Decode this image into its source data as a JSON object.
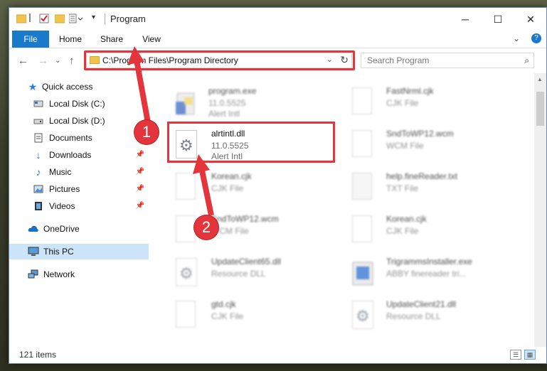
{
  "titlebar": {
    "title": "Program",
    "minimize": "─",
    "maximize": "☐",
    "close": "✕"
  },
  "ribbon": {
    "tabs": [
      {
        "label": "File"
      },
      {
        "label": "Home"
      },
      {
        "label": "Share"
      },
      {
        "label": "View"
      }
    ],
    "collapse": "⌄",
    "help": "?"
  },
  "nav": {
    "back": "←",
    "forward": "→",
    "recent": "⌄",
    "up": "↑"
  },
  "address": {
    "path": "C:\\Program Files\\Program Directory",
    "dropdown": "⌄",
    "refresh": "↻"
  },
  "search": {
    "placeholder": "Search Program",
    "icon": "⌕"
  },
  "sidebar": {
    "items": [
      {
        "label": "Quick access"
      },
      {
        "label": "Local Disk (C:)"
      },
      {
        "label": "Local Disk (D:)"
      },
      {
        "label": "Documents"
      },
      {
        "label": "Downloads",
        "pin": "📌"
      },
      {
        "label": "Music",
        "pin": "📌"
      },
      {
        "label": "Pictures",
        "pin": "📌"
      },
      {
        "label": "Videos",
        "pin": "📌"
      },
      {
        "label": "OneDrive"
      },
      {
        "label": "This PC"
      },
      {
        "label": "Network"
      }
    ]
  },
  "files": [
    {
      "name": "program.exe",
      "l1": "11.0.5525",
      "l2": "Alert Intl",
      "icon": "exe-icon"
    },
    {
      "name": "FastNrml.cjk",
      "l1": "CJK File",
      "l2": "",
      "icon": "file-icon"
    },
    {
      "name": "alrtintl.dll",
      "l1": "11.0.5525",
      "l2": "Alert Intl",
      "icon": "dll-gear-icon"
    },
    {
      "name": "SndToWP12.wcm",
      "l1": "WCM File",
      "l2": "",
      "icon": "file-icon"
    },
    {
      "name": "Korean.cjk",
      "l1": "CJK File",
      "l2": "",
      "icon": "file-icon"
    },
    {
      "name": "help.fineReader.txt",
      "l1": "TXT File",
      "l2": "",
      "icon": "txt-icon"
    },
    {
      "name": "SndToWP12.wcm",
      "l1": "WCM File",
      "l2": "",
      "icon": "file-icon"
    },
    {
      "name": "Korean.cjk",
      "l1": "CJK File",
      "l2": "",
      "icon": "file-icon"
    },
    {
      "name": "UpdateClient65.dll",
      "l1": "Resource DLL",
      "l2": "",
      "icon": "dll-gear-icon"
    },
    {
      "name": "TrigrammsInstaller.exe",
      "l1": "ABBY finereader tri...",
      "l2": "",
      "icon": "installer-icon"
    },
    {
      "name": "gtd.cjk",
      "l1": "CJK File",
      "l2": "",
      "icon": "file-icon"
    },
    {
      "name": "UpdateClient21.dll",
      "l1": "Resource DLL",
      "l2": "",
      "icon": "dll-gear-icon"
    }
  ],
  "status": {
    "count": "121 items"
  },
  "annotations": {
    "step1": "1",
    "step2": "2"
  },
  "colors": {
    "accent": "#1979ca",
    "highlight": "#e3353b",
    "selected": "#cce4f7"
  }
}
